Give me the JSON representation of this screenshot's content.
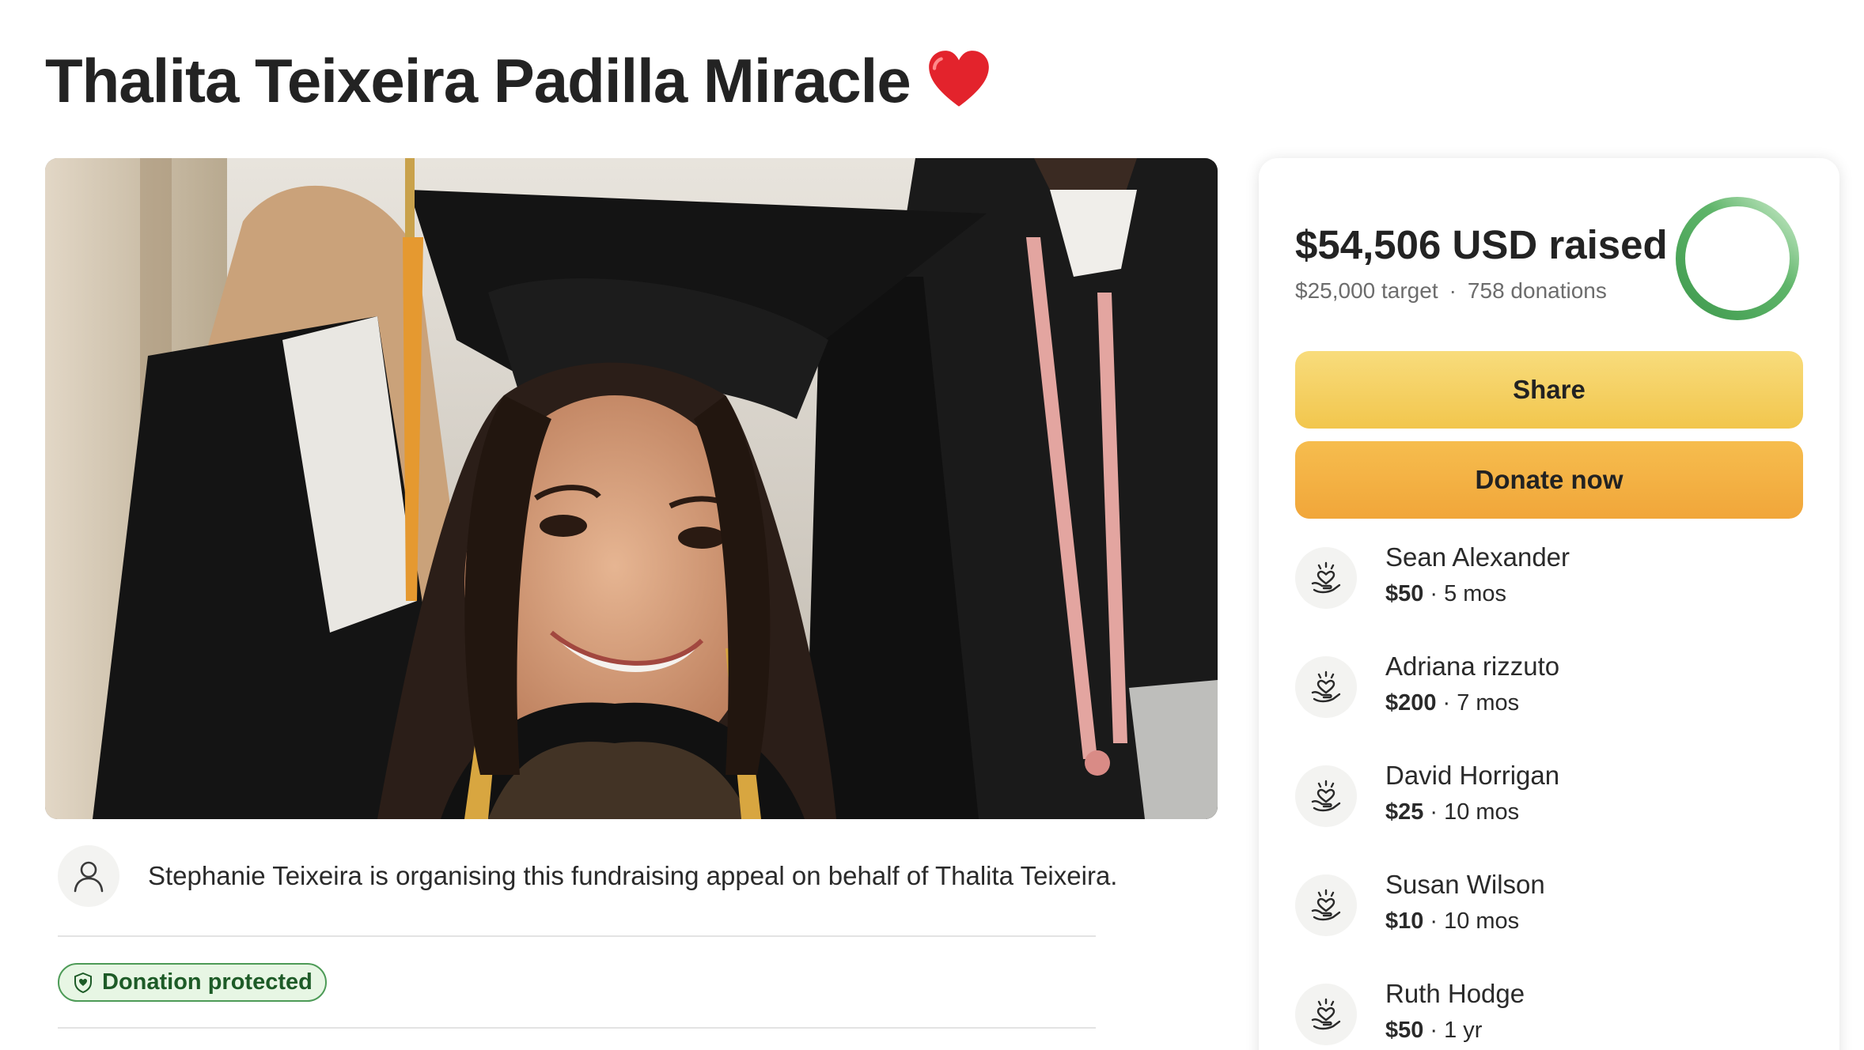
{
  "page": {
    "title": "Thalita Teixeira Padilla Miracle",
    "title_icon": "red-heart-emoji"
  },
  "hero_image": {
    "description_icon": "graduation-photo"
  },
  "organiser": {
    "icon": "person-icon",
    "text": "Stephanie Teixeira is organising this fundraising appeal on behalf of Thalita Teixeira."
  },
  "badge": {
    "icon": "shield-heart-icon",
    "label": "Donation protected"
  },
  "panel": {
    "raised_text": "$54,506 USD raised",
    "target_text": "$25,000 target",
    "separator": "·",
    "donations_count_text": "758 donations",
    "progress_fraction": 1.0,
    "share_label": "Share",
    "donate_label": "Donate now",
    "donations": [
      {
        "name": "Sean Alexander",
        "amount": "$50",
        "sep": "·",
        "time": "5 mos"
      },
      {
        "name": "Adriana rizzuto",
        "amount": "$200",
        "sep": "·",
        "time": "7 mos"
      },
      {
        "name": "David Horrigan",
        "amount": "$25",
        "sep": "·",
        "time": "10 mos"
      },
      {
        "name": "Susan Wilson",
        "amount": "$10",
        "sep": "·",
        "time": "10 mos"
      },
      {
        "name": "Ruth Hodge",
        "amount": "$50",
        "sep": "·",
        "time": "1 yr"
      }
    ]
  },
  "colors": {
    "accent_green": "#4d9b57",
    "share_yellow": "#f2c64d",
    "donate_orange": "#f1a63a"
  }
}
